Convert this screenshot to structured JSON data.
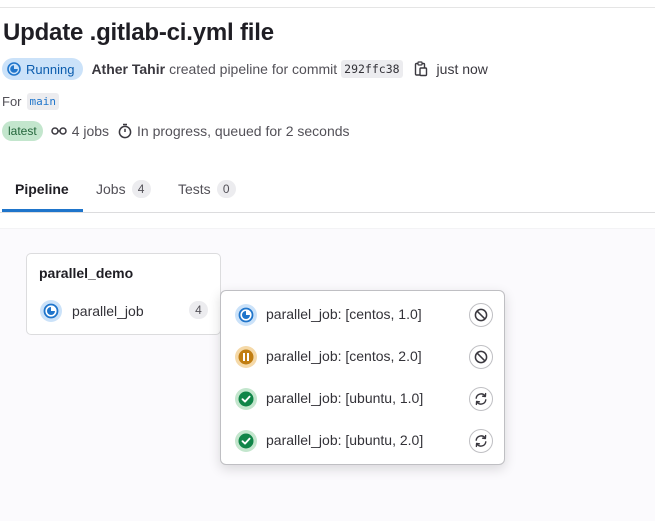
{
  "pipeline": {
    "title": "Update .gitlab-ci.yml file",
    "status_label": "Running",
    "author": "Ather Tahir",
    "created_text": "created pipeline for commit",
    "commit_sha": "292ffc38",
    "time": "just now",
    "for_label": "For",
    "branch": "main",
    "latest_label": "latest",
    "jobs_count_text": "4 jobs",
    "progress_text": "In progress, queued for 2 seconds"
  },
  "tabs": [
    {
      "label": "Pipeline",
      "count": ""
    },
    {
      "label": "Jobs",
      "count": "4"
    },
    {
      "label": "Tests",
      "count": "0"
    }
  ],
  "graph": {
    "stage_name": "parallel_demo",
    "group_name": "parallel_job",
    "group_count": "4",
    "jobs": [
      {
        "name": "parallel_job: [centos, 1.0]",
        "status": "running",
        "action": "cancel-icon"
      },
      {
        "name": "parallel_job: [centos, 2.0]",
        "status": "pending",
        "action": "cancel-icon"
      },
      {
        "name": "parallel_job: [ubuntu, 1.0]",
        "status": "success",
        "action": "retry-icon"
      },
      {
        "name": "parallel_job: [ubuntu, 2.0]",
        "status": "success",
        "action": "retry-icon"
      }
    ]
  },
  "colors": {
    "running": "#1f75cb",
    "pending": "#c17d10",
    "success": "#108548",
    "tab_active": "#1f75cb"
  }
}
